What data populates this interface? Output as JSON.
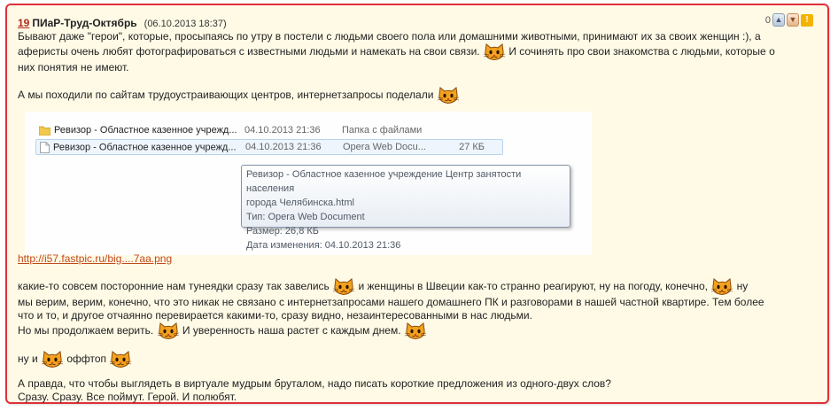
{
  "post": {
    "number": "19",
    "author": "ПИаР-Труд-Октябрь",
    "date": "(06.10.2013 18:37)",
    "rating": "0",
    "icons": {
      "like": "thumbs-up-icon",
      "dislike": "thumbs-down-icon",
      "report": "warning-icon",
      "smiley": "cat-smiley-icon"
    },
    "colors": {
      "border": "#e0303a",
      "background": "#fffae6",
      "link": "#c04a1a",
      "number": "#b22a1a"
    },
    "p1_a": "Бывают даже \"герои\", которые, просыпаясь по утру в постели с людьми своего пола или домашними животными, принимают их за своих женщин :), а",
    "p1_b": "аферисты очень любят фотографироваться с известными людьми и намекать на свои связи.",
    "p1_c": "И сочинять про свои знакомства с людьми, которые о",
    "p1_d": "них понятия не имеют.",
    "p2": "А мы походили по сайтам трудоустраивающих центров, интернетзапросы поделали",
    "screenshot": {
      "rows": [
        {
          "name": "Ревизор - Областное казенное учрежд...",
          "date": "04.10.2013 21:36",
          "type": "Папка с файлами",
          "size": "",
          "icon": "folder-icon"
        },
        {
          "name": "Ревизор - Областное казенное учрежд...",
          "date": "04.10.2013 21:36",
          "type": "Opera Web Docu...",
          "size": "27 КБ",
          "icon": "document-icon"
        }
      ],
      "tooltip": {
        "line1": "Ревизор - Областное казенное учреждение Центр занятости населения",
        "line2": "города Челябинска.html",
        "line3": "Тип: Opera Web Document",
        "line4": "Размер: 26,8 КБ",
        "line5": "Дата изменения: 04.10.2013 21:36"
      }
    },
    "link": "http://i57.fastpic.ru/big....7aa.png",
    "p3_a": "какие-то совсем посторонние нам тунеядки сразу так завелись",
    "p3_b": "и женщины в Швеции как-то странно реагируют, ну на погоду, конечно,",
    "p3_c": "ну",
    "p3_d": "мы верим, верим, конечно, что это никак не связано с интернетзапросами нашего домашнего ПК и разговорами в нашей частной квартире. Тем более",
    "p3_e": "что и то, и другое отчаянно перевирается какими-то, сразу видно, незаинтересованными в нас людьми.",
    "p3_f": "Но мы продолжаем верить.",
    "p3_g": "И уверенность наша растет с каждым днем.",
    "p4_a": "ну и",
    "p4_b": "оффтоп",
    "p5_a": "А правда, что чтобы выглядеть в виртуале мудрым бруталом, надо писать короткие предложения из одного-двух слов?",
    "p5_b": "Сразу. Сразу. Все поймут. Герой. И полюбят."
  }
}
